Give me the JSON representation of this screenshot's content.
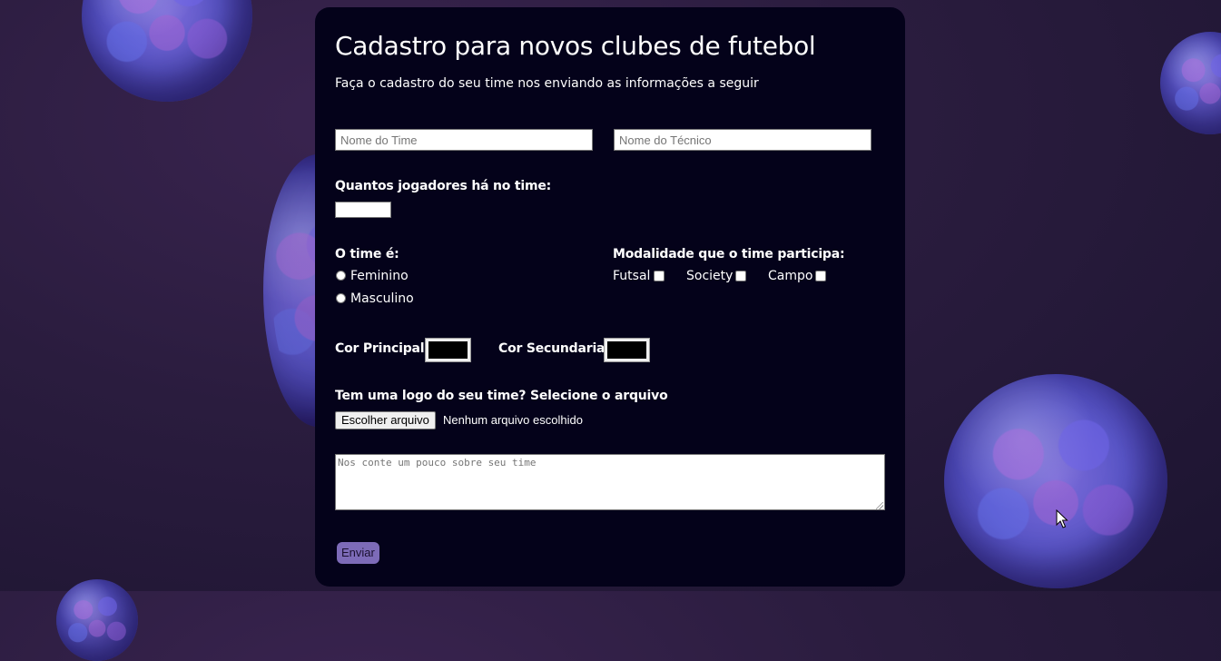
{
  "form": {
    "title": "Cadastro para novos clubes de futebol",
    "subtitle": "Faça o cadastro do seu time nos enviando as informações a seguir",
    "team_name_placeholder": "Nome do Time",
    "coach_name_placeholder": "Nome do Técnico",
    "players_label": "Quantos jogadores há no time:",
    "gender_label": "O time é:",
    "gender_options": [
      "Feminino",
      "Masculino"
    ],
    "modality_label": "Modalidade que o time participa:",
    "modality_options": [
      "Futsal",
      "Society",
      "Campo"
    ],
    "primary_color_label": "Cor Principal:",
    "primary_color_value": "#000000",
    "secondary_color_label": "Cor Secundaria:",
    "secondary_color_value": "#000000",
    "logo_label": "Tem uma logo do seu time? Selecione o arquivo",
    "file_button": "Escolher arquivo",
    "file_status": "Nenhum arquivo escolhido",
    "description_placeholder": "Nos conte um pouco sobre seu time",
    "submit_label": "Enviar"
  },
  "colors": {
    "card_background": "#04021a",
    "submit_button": "#7d6bb8",
    "page_background": "#2a1c3e",
    "ball_color": "#5a56c8"
  },
  "icons": [
    "soccer-ball-icon",
    "mouse-cursor-icon"
  ]
}
